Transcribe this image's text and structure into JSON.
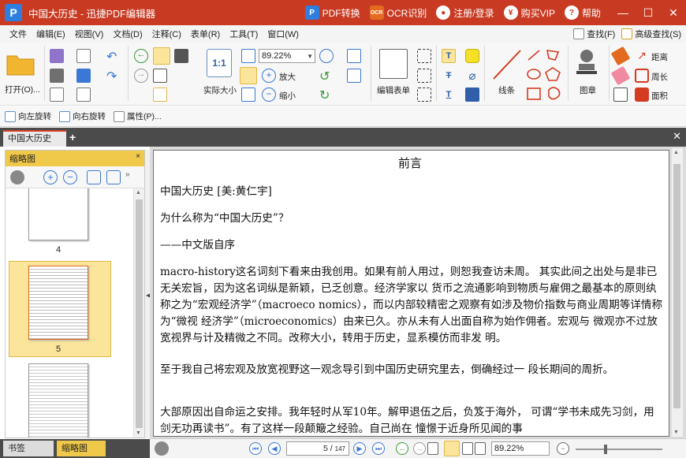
{
  "app": {
    "logo_letter": "P",
    "title": "中国大历史 - 迅捷PDF编辑器",
    "actions": [
      {
        "label": "PDF转换",
        "icon": "pdf-convert-icon"
      },
      {
        "label": "OCR识别",
        "icon": "ocr-icon"
      },
      {
        "label": "注册/登录",
        "icon": "user-icon"
      },
      {
        "label": "购买VIP",
        "icon": "yen-icon"
      },
      {
        "label": "帮助",
        "icon": "help-icon"
      }
    ],
    "window_controls": [
      "—",
      "☐",
      "✕"
    ]
  },
  "menu": {
    "items": [
      "文件",
      "编辑(E)",
      "视图(V)",
      "文档(D)",
      "注释(C)",
      "表单(R)",
      "工具(T)",
      "窗口(W)"
    ],
    "find": "查找(F)",
    "advanced_find": "高级查找(S)"
  },
  "ribbon": {
    "open": "打开(O)...",
    "actual_size_icon": "1:1",
    "actual_size": "实际大小",
    "zoom_value": "89.22%",
    "zoom_in": "放大",
    "zoom_out": "缩小",
    "edit_form": "编辑表单",
    "line": "线条",
    "stamp": "图章",
    "distance": "距离",
    "perimeter": "周长",
    "area": "面积"
  },
  "toolbar2": {
    "rotate_left": "向左旋转",
    "rotate_right": "向右旋转",
    "properties": "属性(P)..."
  },
  "tabs": {
    "document_tab": "中国大历史",
    "plus": "+",
    "close": "✕"
  },
  "left_panel": {
    "title": "缩略图",
    "close": "×",
    "pages": [
      "4",
      "5"
    ]
  },
  "bottom_tabs": {
    "bookmarks": "书签",
    "thumbnails": "缩略图"
  },
  "document": {
    "heading": "前言",
    "paragraphs": [
      "中国大历史 [美:黄仁宇]",
      "为什么称为“中国大历史”？",
      "——中文版自序",
      "macro-history这名词刻下看来由我创用。如果有前人用过，则恕我查访未周。 其实此间之出处与是非已无关宏旨，因为这名词纵是新颖，已乏创意。经济学家以 货币之流通影响到物质与雇佣之最基本的原则纨称之为“宏观经济学”（macroeco nomics），而以内部较精密之观察有如涉及物价指数与商业周期等详情称为“微视 经济学”（microeconomics）由来已久。亦从未有人出面自称为始作佣者。宏观与 微观亦不过放宽视界与计及精微之不同。改称大小，转用于历史，显系模仿而非发 明。",
      "至于我自己将宏观及放宽视野这一观念导引到中国历史研究里去，倒确经过一 段长期间的周折。",
      "大部原因出自命运之安排。我年轻时从军10年。解甲退伍之后，负笈于海外， 可谓“学书未成先习剑，用剑无功再读书”。有了这样一段颠簸之经验。自己尚在 憧憬于近身所见闻的事"
    ]
  },
  "statusbar": {
    "page_current": "5",
    "page_total": "147",
    "zoom": "89.22%"
  }
}
